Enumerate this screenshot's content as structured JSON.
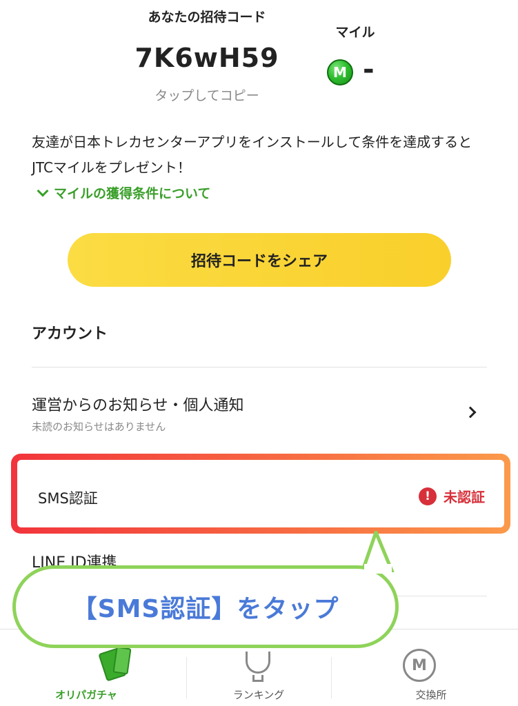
{
  "invite": {
    "label": "あなたの招待コード",
    "code": "7K6wH59",
    "copy_hint": "タップしてコピー"
  },
  "mile": {
    "label": "マイル",
    "icon_letter": "M",
    "value": "-"
  },
  "description": "友達が日本トレカセンターアプリをインストールして条件を達成するとJTCマイルをプレゼント！",
  "mile_conditions_label": "マイルの獲得条件について",
  "share_button_label": "招待コードをシェア",
  "account": {
    "heading": "アカウント",
    "notice": {
      "title": "運営からのお知らせ・個人通知",
      "subtitle": "未読のお知らせはありません"
    },
    "sms": {
      "label": "SMS認証",
      "status": "未認証",
      "alert_glyph": "!"
    },
    "line_label": "LINE ID連携"
  },
  "callout_text": "【SMS認証】をタップ",
  "bottom_nav": {
    "items": [
      {
        "label": "オリパガチャ",
        "icon": "card-pack-icon"
      },
      {
        "label": "ランキング",
        "icon": "trophy-icon"
      },
      {
        "label": "交換所",
        "icon": "exchange-icon",
        "icon_letter": "M"
      }
    ]
  },
  "colors": {
    "accent_green": "#3a9f2a",
    "share_yellow": "#fbdc43",
    "alert_red": "#d7303a",
    "callout_border": "#8ed35a",
    "callout_text": "#4a7ad8"
  }
}
